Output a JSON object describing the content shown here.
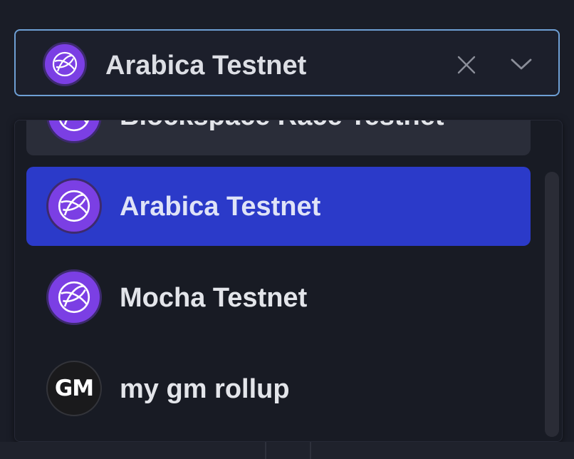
{
  "select": {
    "value": "Arabica Testnet",
    "icon": "celestia-globe-icon",
    "clear_icon": "close-icon",
    "toggle_icon": "chevron-down-icon"
  },
  "options": [
    {
      "label": "Blockspace Race Testnet",
      "icon": "celestia-globe-icon",
      "state": "hovered"
    },
    {
      "label": "Arabica Testnet",
      "icon": "celestia-globe-icon",
      "state": "selected"
    },
    {
      "label": "Mocha Testnet",
      "icon": "celestia-globe-icon",
      "state": "default"
    },
    {
      "label": "my gm rollup",
      "icon": "gm-avatar",
      "avatar_text": "GM",
      "state": "default"
    }
  ],
  "colors": {
    "focus_border": "#6e9fd4",
    "selected_bg": "#2b3ac9",
    "hover_bg": "#2a2d39",
    "brand_purple": "#7b3fe4"
  }
}
